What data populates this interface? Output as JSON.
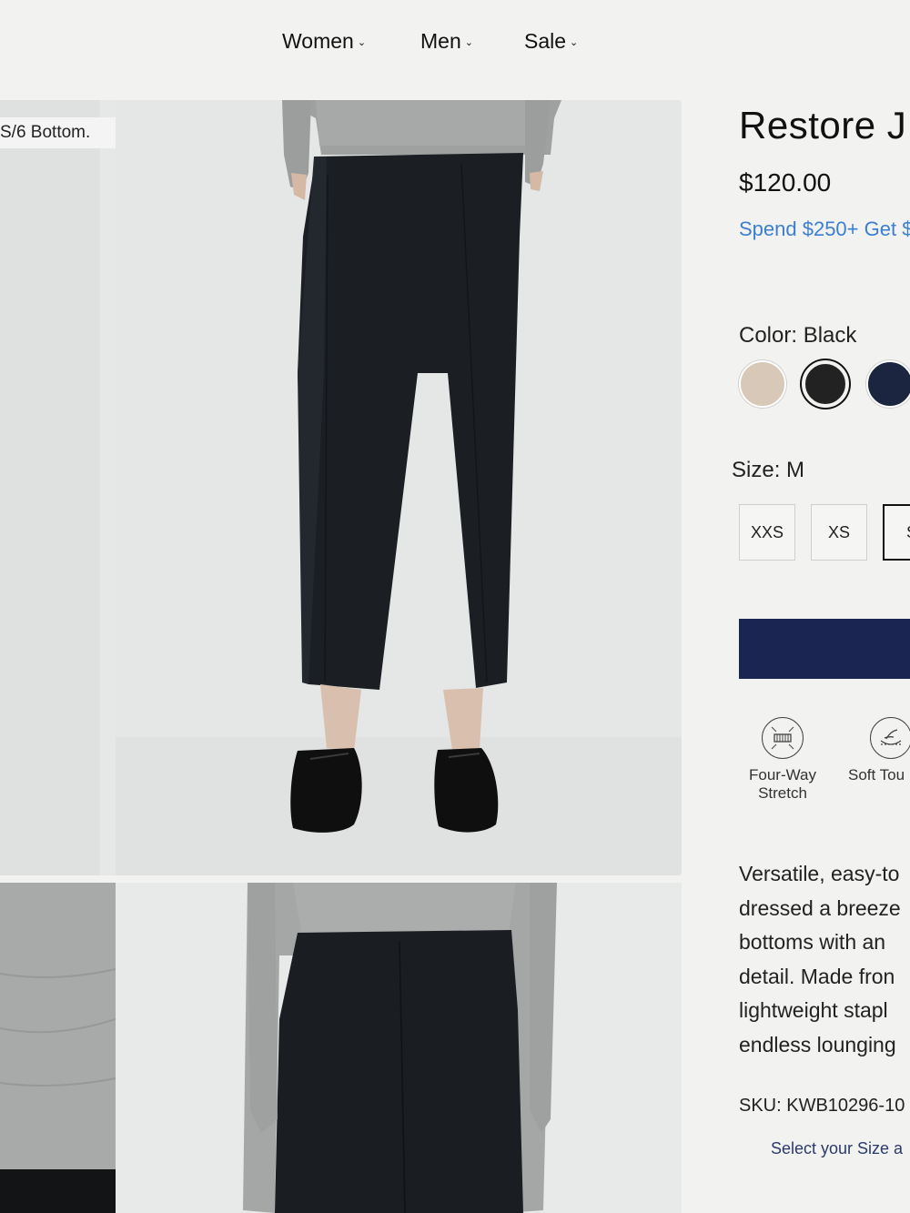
{
  "nav": {
    "items": [
      {
        "label": "Women"
      },
      {
        "label": "Men"
      },
      {
        "label": "Sale"
      }
    ]
  },
  "gallery": {
    "caption": "S/6 Bottom."
  },
  "product": {
    "title": "Restore J",
    "price": "$120.00",
    "promo": "Spend $250+ Get $",
    "color_label": "Color: Black",
    "colors": [
      "#d8c8b8",
      "#222222",
      "#1c2540"
    ],
    "size_label": "Size: M",
    "sizes": [
      "XXS",
      "XS",
      "S"
    ],
    "add_button_color": "#1b2552",
    "features": [
      {
        "icon": "stretch-icon",
        "label_line1": "Four-Way",
        "label_line2": "Stretch"
      },
      {
        "icon": "soft-touch-icon",
        "label_line1": "Soft Tou",
        "label_line2": ""
      }
    ],
    "description_lines": [
      "Versatile, easy-to",
      "dressed a breeze",
      "bottoms with an",
      "detail. Made fron",
      "lightweight stapl",
      "endless lounging"
    ],
    "sku": "SKU: KWB10296-10",
    "select_size_note": "Select your Size a"
  }
}
